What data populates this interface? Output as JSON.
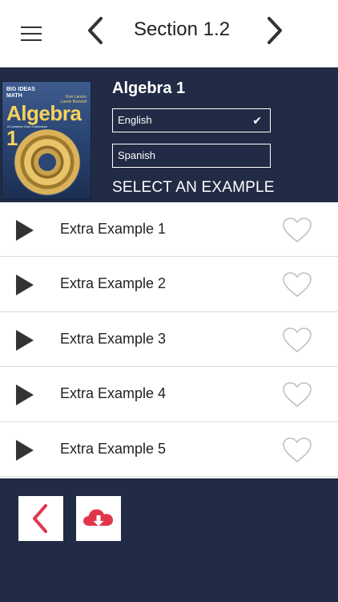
{
  "header": {
    "section_title": "Section 1.2",
    "icons": {
      "menu": "hamburger-menu-icon",
      "prev": "chevron-left-icon",
      "next": "chevron-right-icon"
    }
  },
  "book": {
    "title": "Algebra 1",
    "cover": {
      "brand_line1": "BIG IDEAS",
      "brand_line2": "MATH",
      "authors_line1": "Ron Larson",
      "authors_line2": "Laurie Boswell",
      "title": "Algebra 1",
      "subtitle": "A Common Core Curriculum"
    },
    "languages": [
      {
        "label": "English",
        "selected": true
      },
      {
        "label": "Spanish",
        "selected": false
      }
    ],
    "select_prompt": "SELECT AN EXAMPLE"
  },
  "examples": [
    {
      "label": "Extra Example 1",
      "favorite": false
    },
    {
      "label": "Extra Example 2",
      "favorite": false
    },
    {
      "label": "Extra Example 3",
      "favorite": false
    },
    {
      "label": "Extra Example 4",
      "favorite": false
    },
    {
      "label": "Extra Example 5",
      "favorite": false
    }
  ],
  "footer": {
    "icons": {
      "back": "chevron-left-icon",
      "download": "cloud-download-icon"
    }
  },
  "colors": {
    "navy": "#222b45",
    "accent_red": "#e0364c",
    "divider": "#dcdcdc",
    "white": "#ffffff"
  }
}
